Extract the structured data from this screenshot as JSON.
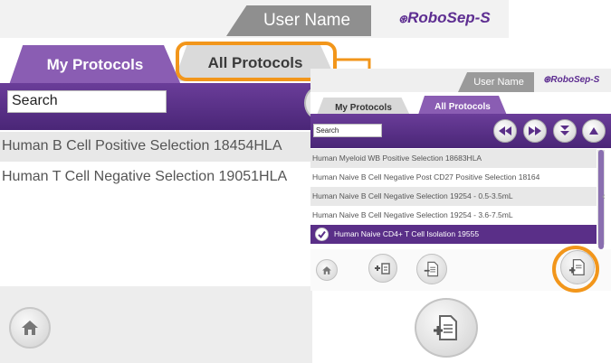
{
  "large_view": {
    "user_name": "User Name",
    "logo": "RoboSep",
    "logo_suffix": "-S",
    "tabs": [
      {
        "label": "My Protocols"
      },
      {
        "label": "All Protocols"
      }
    ],
    "search": {
      "value": "Search"
    },
    "protocols": [
      {
        "label": "Human B Cell Positive Selection 18454HLA"
      },
      {
        "label": "Human T Cell Negative Selection 19051HLA"
      }
    ]
  },
  "small_view": {
    "user_name": "User Name",
    "logo": "RoboSep",
    "logo_suffix": "-S",
    "tabs": [
      {
        "label": "My Protocols"
      },
      {
        "label": "All Protocols"
      }
    ],
    "search": {
      "value": "Search"
    },
    "protocols": [
      {
        "label": "Human Myeloid WB Positive Selection 18683HLA"
      },
      {
        "label": "Human Naive B Cell Negative Post CD27 Positive Selection 18164"
      },
      {
        "label": "Human Naive B Cell Negative Selection 19254 - 0.5-3.5mL"
      },
      {
        "label": "Human Naive B Cell Negative Selection 19254 - 3.6-7.5mL"
      },
      {
        "label": "Human Naive CD4+ T Cell Isolation 19555"
      }
    ]
  },
  "colors": {
    "accent": "#5d2d91",
    "highlight": "#f2961b"
  },
  "icons": [
    "home-icon",
    "add-protocol-icon",
    "export-protocol-icon",
    "rewind-icon",
    "fast-forward-icon",
    "down-icon",
    "up-icon",
    "check-icon"
  ]
}
